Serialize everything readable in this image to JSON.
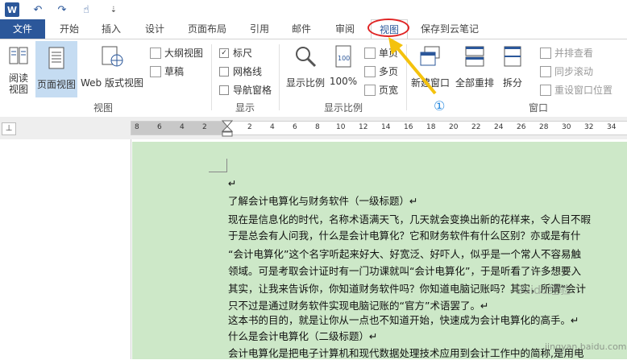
{
  "app": {
    "logo": "W"
  },
  "quick_access": {
    "undo": "↶",
    "redo": "↷",
    "touch": "☝",
    "more": "⇣"
  },
  "tabs": [
    "文件",
    "开始",
    "插入",
    "设计",
    "页面布局",
    "引用",
    "邮件",
    "审阅",
    "视图",
    "保存到云笔记"
  ],
  "active_tab": "视图",
  "ribbon": {
    "views": {
      "read": "阅读\n视图",
      "read_l1": "阅读",
      "read_l2": "视图",
      "print": "页面视图",
      "web": "Web 版式视图",
      "outline": "大纲视图",
      "draft": "草稿",
      "label": "视图"
    },
    "show": {
      "ruler": "标尺",
      "ruler_checked": true,
      "gridlines": "网格线",
      "nav_pane": "导航窗格",
      "label": "显示"
    },
    "zoom": {
      "zoom": "显示比例",
      "hundred": "100%",
      "one_page": "单页",
      "multi_page": "多页",
      "page_width": "页宽",
      "label": "显示比例"
    },
    "window": {
      "new_window": "新建窗口",
      "arrange_all": "全部重排",
      "split": "拆分",
      "side_by_side": "并排查看",
      "sync_scroll": "同步滚动",
      "reset_pos": "重设窗口位置",
      "label": "窗口"
    }
  },
  "ruler": {
    "corner": "⊥",
    "ticks_left": [
      "8",
      "6",
      "4",
      "2"
    ],
    "ticks_right": [
      "2",
      "4",
      "6",
      "8",
      "10",
      "12",
      "14",
      "16",
      "18",
      "20",
      "22",
      "24",
      "26",
      "28",
      "30",
      "32",
      "34"
    ]
  },
  "annotation": {
    "number": "①"
  },
  "document": {
    "lines": [
      "↵",
      "了解会计电算化与财务软件（一级标题）↵",
      "现在是信息化的时代，名称术语满天飞，几天就会变换出新的花样来，令人目不暇",
      "于是总会有人问我，什么是会计电算化？它和财务软件有什么区别？亦或是有什",
      "“会计电算化”这个名字听起来好大、好宽泛、好吓人，似乎是一个常人不容易触",
      "领域。可是考取会计证时有一门功课就叫“会计电算化”，于是听看了许多想要入",
      "其实，让我来告诉你，你知道财务软件吗？你知道电脑记账吗？其实，所谓“会计",
      "只不过是通过财务软件实现电脑记账的“官方”术语罢了。↵",
      "这本书的目的，就是让你从一点也不知道开始，快速成为会计电算化的高手。↵",
      "什么是会计电算化（二级标题）↵",
      "会计电算化是把电子计算机和现代数据处理技术应用到会计工作中的简称,是用电"
    ]
  },
  "watermark": {
    "text": "Baidu经验",
    "url": "jingyan.baidu.com"
  }
}
